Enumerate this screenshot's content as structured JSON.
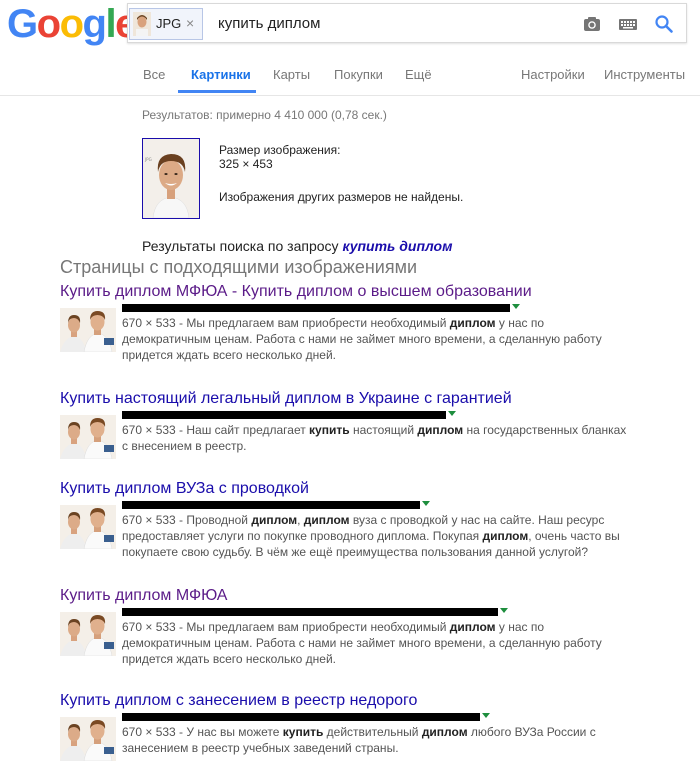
{
  "header": {
    "logo_letters": [
      {
        "ch": "G",
        "color": "#4285F4"
      },
      {
        "ch": "o",
        "color": "#EA4335"
      },
      {
        "ch": "o",
        "color": "#FBBC05"
      },
      {
        "ch": "g",
        "color": "#4285F4"
      },
      {
        "ch": "l",
        "color": "#34A853"
      },
      {
        "ch": "e",
        "color": "#EA4335"
      }
    ],
    "chip_label": "JPG",
    "chip_close": "×",
    "query": "купить диплом",
    "icons": [
      "camera-icon",
      "keyboard-icon",
      "search-icon"
    ]
  },
  "nav": {
    "tabs": [
      "Все",
      "Картинки",
      "Карты",
      "Покупки",
      "Ещё"
    ],
    "active_tab": "Картинки",
    "settings": "Настройки",
    "tools": "Инструменты"
  },
  "stats": "Результатов: примерно 4 410 000 (0,78 сек.)",
  "image_info": {
    "size_label": "Размер изображения:",
    "size_value": "325 × 453",
    "no_other_sizes": "Изображения других размеров не найдены."
  },
  "results_for": {
    "prefix": "Результаты поиска по запросу ",
    "query": "купить диплом"
  },
  "section_title": "Страницы с подходящими изображениями",
  "colors": {
    "link": "#1a0dab",
    "visited": "#5b1b88",
    "active_tab": "#1a73e8",
    "url_arrow": "#1e8e3e",
    "redaction": "#000000"
  },
  "results": [
    {
      "title": "Купить диплом МФЮА - Купить диплом о высшем образовании",
      "visited": true,
      "snippet_parts": [
        {
          "t": "670 × 533 - Мы предлагаем вам приобрести необходимый "
        },
        {
          "b": "диплом"
        },
        {
          "t": " у нас по демократичным ценам. Работа с нами не займет много времени, а сделанную работу придется ждать всего несколько дней."
        }
      ]
    },
    {
      "title": "Купить настоящий легальный диплом в Украине с гарантией",
      "visited": false,
      "snippet_parts": [
        {
          "t": "670 × 533 - Наш сайт предлагает "
        },
        {
          "b": "купить"
        },
        {
          "t": " настоящий "
        },
        {
          "b": "диплом"
        },
        {
          "t": " на государственных бланках с внесением в реестр."
        }
      ]
    },
    {
      "title": "Купить диплом ВУЗа с проводкой",
      "visited": false,
      "snippet_parts": [
        {
          "t": "670 × 533 - Проводной "
        },
        {
          "b": "диплом"
        },
        {
          "t": ", "
        },
        {
          "b": "диплом"
        },
        {
          "t": " вуза с проводкой у нас на сайте. Наш ресурс предоставляет услуги по покупке проводного диплома. Покупая "
        },
        {
          "b": "диплом"
        },
        {
          "t": ", очень часто вы покупаете свою судьбу. В чём же ещё преимущества пользования данной услугой?"
        }
      ]
    },
    {
      "title": "Купить диплом МФЮА",
      "visited": true,
      "snippet_parts": [
        {
          "t": "670 × 533 - Мы предлагаем вам приобрести необходимый "
        },
        {
          "b": "диплом"
        },
        {
          "t": " у нас по демократичным ценам. Работа с нами не займет много времени, а сделанную работу придется ждать всего несколько дней."
        }
      ]
    },
    {
      "title": "Купить диплом с занесением в реестр недорого",
      "visited": false,
      "snippet_parts": [
        {
          "t": "670 × 533 - У нас вы можете "
        },
        {
          "b": "купить"
        },
        {
          "t": " действительный "
        },
        {
          "b": "диплом"
        },
        {
          "t": " любого ВУЗа России с занесением в реестр учебных заведений страны."
        }
      ]
    }
  ]
}
